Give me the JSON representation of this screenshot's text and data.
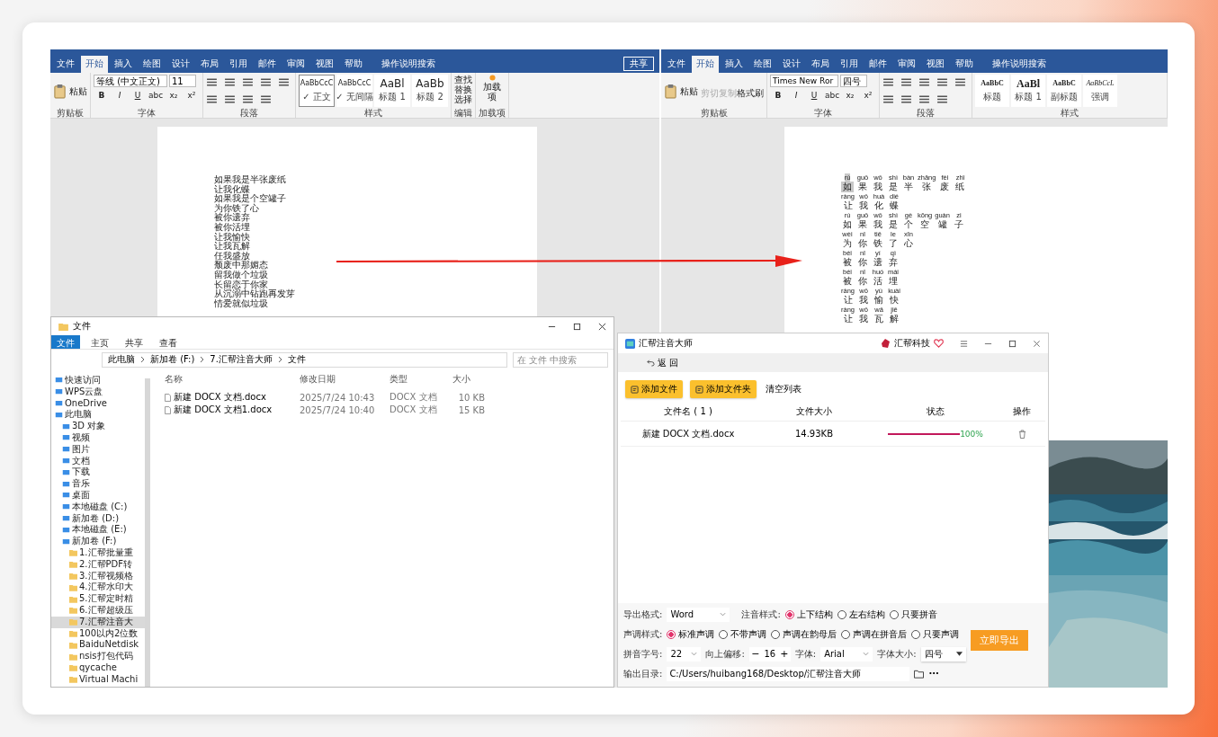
{
  "word_left": {
    "tabs": [
      {
        "label": "文件",
        "selected": false
      },
      {
        "label": "开始",
        "selected": true
      },
      {
        "label": "插入",
        "selected": false
      },
      {
        "label": "绘图",
        "selected": false
      },
      {
        "label": "设计",
        "selected": false
      },
      {
        "label": "布局",
        "selected": false
      },
      {
        "label": "引用",
        "selected": false
      },
      {
        "label": "邮件",
        "selected": false
      },
      {
        "label": "审阅",
        "selected": false
      },
      {
        "label": "视图",
        "selected": false
      },
      {
        "label": "帮助",
        "selected": false
      }
    ],
    "search": "操作说明搜索",
    "share": "共享",
    "paste": "粘贴",
    "font": "等线 (中文正文)",
    "size": "11",
    "format": [
      "B",
      "I",
      "U",
      "abc",
      "x₂",
      "x²"
    ],
    "styles": [
      {
        "sample": "AaBbCcC",
        "name": "✓ 正文",
        "selected": true
      },
      {
        "sample": "AaBbCcC",
        "name": "✓ 无间隔",
        "selected": false
      },
      {
        "sample": "AaBl",
        "name": "标题 1",
        "selected": false
      },
      {
        "sample": "AaBb",
        "name": "标题 2",
        "selected": false
      }
    ],
    "editing": [
      "查找",
      "替换",
      "选择"
    ],
    "addin": "加载项",
    "groups": [
      "剪贴板",
      "字体",
      "段落",
      "样式",
      "编辑",
      "加载项"
    ],
    "lines": [
      "如果我是半张废纸",
      "让我化蝶",
      "如果我是个空罐子",
      "为你铁了心",
      "被你遗弃",
      "被你活埋",
      "让我愉快",
      "让我瓦解",
      "任我盛放",
      "颓废中那媚态",
      "留我做个垃圾",
      "长留恋于你家",
      "从沉溺中钻跑再发芽",
      "情爱就似垃圾"
    ]
  },
  "word_right": {
    "tabs": [
      {
        "label": "文件",
        "selected": false
      },
      {
        "label": "开始",
        "selected": true
      },
      {
        "label": "插入",
        "selected": false
      },
      {
        "label": "绘图",
        "selected": false
      },
      {
        "label": "设计",
        "selected": false
      },
      {
        "label": "布局",
        "selected": false
      },
      {
        "label": "引用",
        "selected": false
      },
      {
        "label": "邮件",
        "selected": false
      },
      {
        "label": "审阅",
        "selected": false
      },
      {
        "label": "视图",
        "selected": false
      },
      {
        "label": "帮助",
        "selected": false
      }
    ],
    "search": "操作说明搜索",
    "paste": "粘贴",
    "clipboard": [
      {
        "label": "剪切",
        "disabled": true
      },
      {
        "label": "复制",
        "disabled": true
      },
      {
        "label": "格式刷",
        "disabled": false
      }
    ],
    "font": "Times New Ror",
    "size": "四号",
    "format": [
      "B",
      "I",
      "U",
      "abc",
      "x₂",
      "x²"
    ],
    "styles": [
      {
        "sample": "AaBbC",
        "name": "标题",
        "selected": false
      },
      {
        "sample": "AaBl",
        "name": "标题 1",
        "selected": false
      },
      {
        "sample": "AaBbC",
        "name": "副标题",
        "selected": false
      },
      {
        "sample": "AaBbCcL",
        "name": "强调",
        "selected": false
      }
    ],
    "groups": [
      "剪贴板",
      "字体",
      "段落",
      "样式"
    ],
    "first_char_selected": true,
    "lines": [
      {
        "pinyin": [
          "rú",
          "guǒ",
          "wǒ",
          "shì",
          "bàn",
          "zhāng",
          "fèi",
          "zhǐ"
        ],
        "hanzi": [
          "如",
          "果",
          "我",
          "是",
          "半",
          "张",
          "废",
          "纸"
        ]
      },
      {
        "pinyin": [
          "ràng",
          "wǒ",
          "huà",
          "dié"
        ],
        "hanzi": [
          "让",
          "我",
          "化",
          "蝶"
        ]
      },
      {
        "pinyin": [
          "rú",
          "guǒ",
          "wǒ",
          "shì",
          "gè",
          "kōng",
          "guàn",
          "zi"
        ],
        "hanzi": [
          "如",
          "果",
          "我",
          "是",
          "个",
          "空",
          "罐",
          "子"
        ]
      },
      {
        "pinyin": [
          "wèi",
          "nǐ",
          "tiě",
          "le",
          "xīn"
        ],
        "hanzi": [
          "为",
          "你",
          "铁",
          "了",
          "心"
        ]
      },
      {
        "pinyin": [
          "bèi",
          "nǐ",
          "yí",
          "qì"
        ],
        "hanzi": [
          "被",
          "你",
          "遗",
          "弃"
        ]
      },
      {
        "pinyin": [
          "bèi",
          "nǐ",
          "huó",
          "mái"
        ],
        "hanzi": [
          "被",
          "你",
          "活",
          "埋"
        ]
      },
      {
        "pinyin": [
          "ràng",
          "wǒ",
          "yú",
          "kuài"
        ],
        "hanzi": [
          "让",
          "我",
          "愉",
          "快"
        ]
      },
      {
        "pinyin": [
          "ràng",
          "wǒ",
          "wǎ",
          "jiě"
        ],
        "hanzi": [
          "让",
          "我",
          "瓦",
          "解"
        ]
      }
    ]
  },
  "explorer": {
    "title": "文件",
    "tabs": [
      {
        "label": "文件",
        "selected": true
      },
      {
        "label": "主页",
        "selected": false
      },
      {
        "label": "共享",
        "selected": false
      },
      {
        "label": "查看",
        "selected": false
      }
    ],
    "breadcrumb": [
      "此电脑",
      "新加卷 (F:)",
      "7.汇帮注音大师",
      "文件"
    ],
    "search": {
      "placeholder": "在 文件 中搜索"
    },
    "tree": [
      {
        "label": "快速访问",
        "selected": false
      },
      {
        "label": "WPS云盘",
        "selected": false
      },
      {
        "label": "OneDrive",
        "selected": false
      },
      {
        "label": "此电脑",
        "selected": false,
        "children": [
          {
            "label": "3D 对象",
            "selected": false
          },
          {
            "label": "视频",
            "selected": false
          },
          {
            "label": "图片",
            "selected": false
          },
          {
            "label": "文档",
            "selected": false
          },
          {
            "label": "下载",
            "selected": false
          },
          {
            "label": "音乐",
            "selected": false
          },
          {
            "label": "桌面",
            "selected": false
          },
          {
            "label": "本地磁盘 (C:)",
            "selected": false
          },
          {
            "label": "新加卷 (D:)",
            "selected": false
          },
          {
            "label": "本地磁盘 (E:)",
            "selected": false
          },
          {
            "label": "新加卷 (F:)",
            "selected": false,
            "children": [
              {
                "label": "1.汇帮批量重",
                "selected": false
              },
              {
                "label": "2.汇帮PDF转",
                "selected": false
              },
              {
                "label": "3.汇帮视频格",
                "selected": false
              },
              {
                "label": "4.汇帮水印大",
                "selected": false
              },
              {
                "label": "5.汇帮定时精",
                "selected": false
              },
              {
                "label": "6.汇帮超级压",
                "selected": false
              },
              {
                "label": "7.汇帮注音大",
                "selected": true
              },
              {
                "label": "100以内2位数",
                "selected": false
              },
              {
                "label": "BaiduNetdisk",
                "selected": false
              },
              {
                "label": "nsis打包代码",
                "selected": false
              },
              {
                "label": "qycache",
                "selected": false
              },
              {
                "label": "Virtual Machi",
                "selected": false
              }
            ]
          }
        ]
      }
    ],
    "columns": [
      "名称",
      "修改日期",
      "类型",
      "大小"
    ],
    "rows": [
      {
        "name": "新建 DOCX 文档.docx",
        "modified": "2025/7/24 10:43",
        "type": "DOCX 文档",
        "size": "10 KB"
      },
      {
        "name": "新建 DOCX 文档1.docx",
        "modified": "2025/7/24 10:40",
        "type": "DOCX 文档",
        "size": "15 KB"
      }
    ]
  },
  "app": {
    "title": "汇帮注音大师",
    "brand": "汇帮科技",
    "back": "返 回",
    "toolbar": [
      {
        "label": "添加文件",
        "kind": "primary"
      },
      {
        "label": "添加文件夹",
        "kind": "primary"
      },
      {
        "label": "清空列表",
        "kind": "plain"
      }
    ],
    "columns": [
      "文件名 ( 1 )",
      "文件大小",
      "状态",
      "操作"
    ],
    "rows": [
      {
        "name": "新建 DOCX 文档.docx",
        "size": "14.93KB",
        "level": 1,
        "percent": "100%"
      }
    ],
    "export_format": {
      "label": "导出格式:",
      "value": "Word"
    },
    "annotation_style": {
      "label": "注音样式:",
      "options": [
        {
          "label": "上下结构",
          "selected": true
        },
        {
          "label": "左右结构",
          "selected": false
        },
        {
          "label": "只要拼音",
          "selected": false
        }
      ]
    },
    "tone_style": {
      "label": "声调样式:",
      "options": [
        {
          "label": "标准声调",
          "selected": true
        },
        {
          "label": "不带声调",
          "selected": false
        },
        {
          "label": "声调在韵母后",
          "selected": false
        },
        {
          "label": "声调在拼音后",
          "selected": false
        },
        {
          "label": "只要声调",
          "selected": false
        }
      ]
    },
    "pinyin_size": {
      "label": "拼音字号:",
      "value": "22"
    },
    "offset": {
      "label": "向上偏移:",
      "minus": "−",
      "value": "16",
      "plus": "+"
    },
    "font": {
      "label": "字体:",
      "value": "Arial"
    },
    "font_size": {
      "label": "字体大小:",
      "value": "四号"
    },
    "export_button": "立即导出",
    "output": {
      "label": "输出目录:",
      "value": "C:/Users/huibang168/Desktop/汇帮注音大师",
      "more": "···"
    }
  }
}
